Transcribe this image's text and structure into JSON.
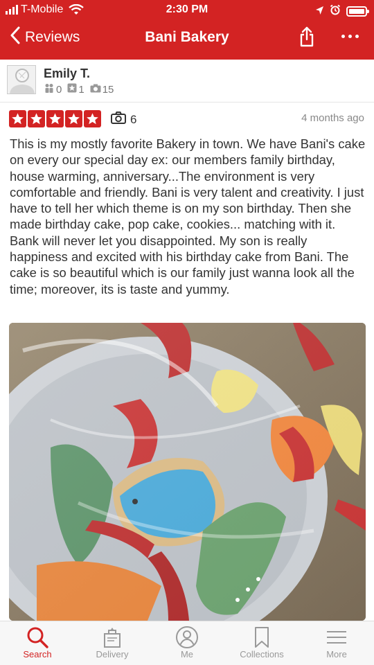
{
  "status_bar": {
    "carrier": "T-Mobile",
    "time": "2:30 PM"
  },
  "nav": {
    "back_label": "Reviews",
    "title": "Bani Bakery"
  },
  "reviewer": {
    "name": "Emily T.",
    "friends": "0",
    "reviews": "1",
    "photos": "15"
  },
  "review": {
    "rating": 5,
    "rating_max": 5,
    "photo_count": "6",
    "date": "4 months ago",
    "text": "This is my mostly favorite Bakery in town. We have Bani's cake on every our special day ex: our members family birthday, house warming, anniversary...The environment is very comfortable and friendly. Bani is very talent and creativity. I just have to tell her which theme is on my son birthday. Then she made birthday cake, pop cake, cookies... matching with it. Bank will never let you disappointed. My son is really happiness and excited with his birthday cake from Bani. The cake is so beautiful which is our family just wanna look all the time; moreover, its is taste and yummy."
  },
  "tabs": [
    {
      "label": "Search",
      "icon": "search-icon",
      "active": true
    },
    {
      "label": "Delivery",
      "icon": "delivery-bag-icon",
      "active": false
    },
    {
      "label": "Me",
      "icon": "profile-icon",
      "active": false
    },
    {
      "label": "Collections",
      "icon": "bookmark-icon",
      "active": false
    },
    {
      "label": "More",
      "icon": "menu-lines-icon",
      "active": false
    }
  ],
  "colors": {
    "brand_red": "#d32323",
    "tab_inactive": "#999999"
  }
}
